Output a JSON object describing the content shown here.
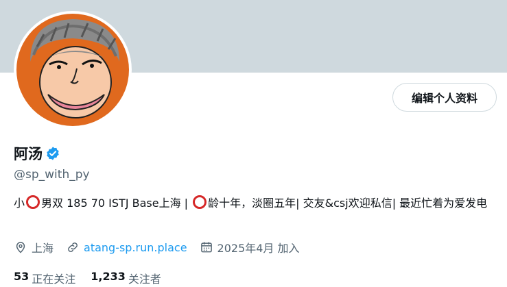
{
  "profile": {
    "name": "阿汤",
    "handle": "@sp_with_py",
    "bio": {
      "part1": "小",
      "part2": "男双 185 70 ISTJ Base上海 | ",
      "part3": "龄十年，淡圈五年| 交友&csj欢迎私信| 最近忙着为爱发电"
    },
    "location": "上海",
    "website": "atang-sp.run.place",
    "joined": "2025年4月 加入",
    "following_count": "53",
    "following_label": "正在关注",
    "followers_count": "1,233",
    "followers_label": "关注者"
  },
  "actions": {
    "edit_label": "编辑个人资料"
  },
  "colors": {
    "banner": "#cfd9de",
    "accent": "#1d9bf0",
    "avatar_bg": "#e0691e"
  },
  "icons": [
    "verified-icon",
    "location-icon",
    "link-icon",
    "calendar-icon"
  ]
}
